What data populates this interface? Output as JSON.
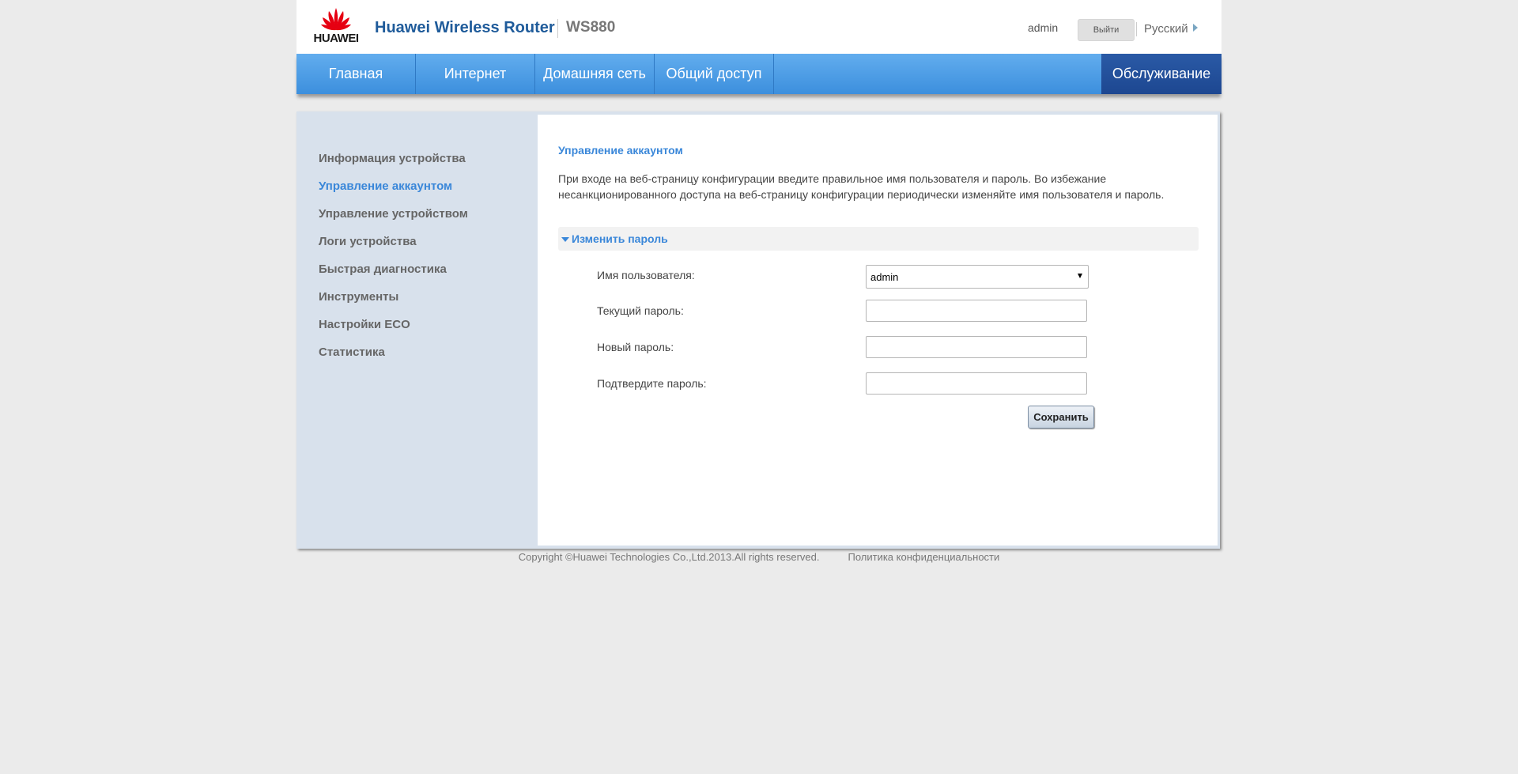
{
  "header": {
    "logo_text": "HUAWEI",
    "product": "Huawei Wireless Router",
    "model": "WS880",
    "user": "admin",
    "logout": "Выйти",
    "language": "Русский"
  },
  "nav": {
    "items": [
      "Главная",
      "Интернет",
      "Домашняя сеть",
      "Общий доступ"
    ],
    "active": "Обслуживание"
  },
  "sidebar": {
    "items": [
      "Информация устройства",
      "Управление аккаунтом",
      "Управление устройством",
      "Логи устройства",
      "Быстрая диагностика",
      "Инструменты",
      "Настройки ECO",
      "Статистика"
    ]
  },
  "main": {
    "title": "Управление аккаунтом",
    "description": "При входе на веб-страницу конфигурации введите правильное имя пользователя и пароль. Во избежание несанкционированного доступа на веб-страницу конфигурации периодически изменяйте имя пользователя и пароль.",
    "section": "Изменить пароль",
    "username_label": "Имя пользователя:",
    "username_value": "admin",
    "current_password_label": "Текущий пароль:",
    "new_password_label": "Новый пароль:",
    "confirm_password_label": "Подтвердите пароль:",
    "save": "Сохранить"
  },
  "footer": {
    "copyright": "Copyright ©Huawei Technologies Co.,Ltd.2013.All rights reserved.",
    "privacy": "Политика конфиденциальности"
  },
  "colors": {
    "accent": "#3a87d9",
    "nav_active": "#1d4791",
    "logo_red": "#e60012"
  }
}
